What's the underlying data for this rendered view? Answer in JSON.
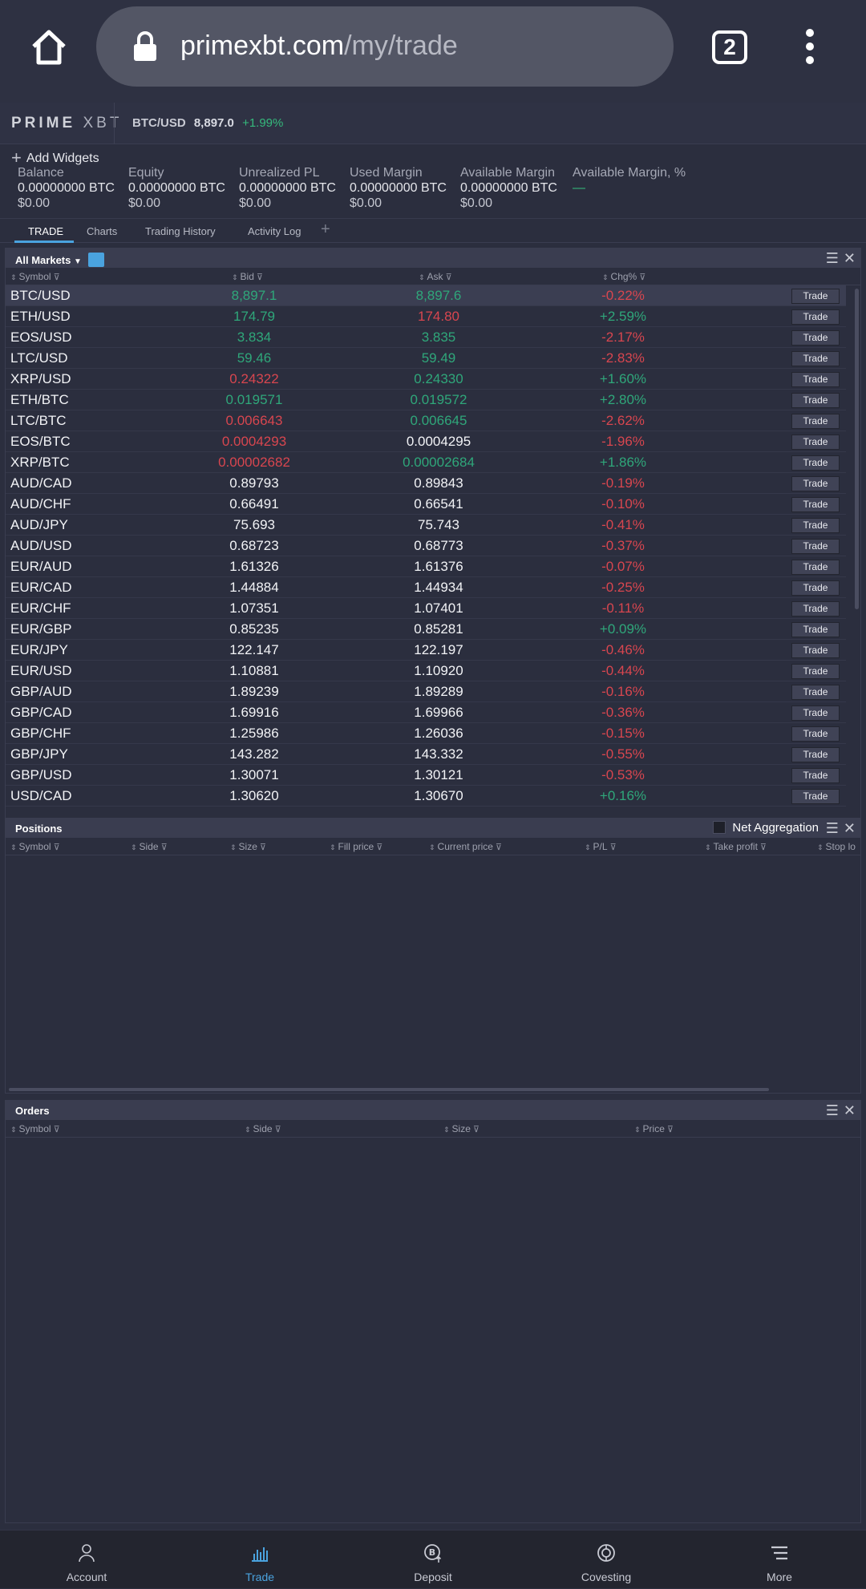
{
  "browser": {
    "domain": "primexbt.com",
    "path": "/my/trade",
    "tab_count": "2"
  },
  "topbar": {
    "logo_a": "PRIME",
    "logo_b": "XBT",
    "symbol": "BTC/USD",
    "price": "8,897.0",
    "change": "+1.99%"
  },
  "summary": {
    "add_widgets": "Add Widgets",
    "metrics": [
      {
        "label": "Balance",
        "value": "0.00000000 BTC",
        "usd": "$0.00"
      },
      {
        "label": "Equity",
        "value": "0.00000000 BTC",
        "usd": "$0.00"
      },
      {
        "label": "Unrealized PL",
        "value": "0.00000000 BTC",
        "usd": "$0.00"
      },
      {
        "label": "Used Margin",
        "value": "0.00000000 BTC",
        "usd": "$0.00"
      },
      {
        "label": "Available Margin",
        "value": "0.00000000 BTC",
        "usd": "$0.00"
      },
      {
        "label": "Available Margin, %",
        "value": "—",
        "usd": ""
      }
    ]
  },
  "tabs": [
    "TRADE",
    "Charts",
    "Trading History",
    "Activity Log"
  ],
  "markets": {
    "title": "All Markets",
    "columns": [
      "Symbol",
      "Bid",
      "Ask",
      "Chg%"
    ],
    "trade_label": "Trade",
    "rows": [
      {
        "symbol": "BTC/USD",
        "bid": "8,897.1",
        "bid_dir": "up",
        "ask": "8,897.6",
        "ask_dir": "up",
        "chg": "-0.22%",
        "chg_dir": "dn"
      },
      {
        "symbol": "ETH/USD",
        "bid": "174.79",
        "bid_dir": "up",
        "ask": "174.80",
        "ask_dir": "dn",
        "chg": "+2.59%",
        "chg_dir": "up"
      },
      {
        "symbol": "EOS/USD",
        "bid": "3.834",
        "bid_dir": "up",
        "ask": "3.835",
        "ask_dir": "up",
        "chg": "-2.17%",
        "chg_dir": "dn"
      },
      {
        "symbol": "LTC/USD",
        "bid": "59.46",
        "bid_dir": "up",
        "ask": "59.49",
        "ask_dir": "up",
        "chg": "-2.83%",
        "chg_dir": "dn"
      },
      {
        "symbol": "XRP/USD",
        "bid": "0.24322",
        "bid_dir": "dn",
        "ask": "0.24330",
        "ask_dir": "up",
        "chg": "+1.60%",
        "chg_dir": "up"
      },
      {
        "symbol": "ETH/BTC",
        "bid": "0.019571",
        "bid_dir": "up",
        "ask": "0.019572",
        "ask_dir": "up",
        "chg": "+2.80%",
        "chg_dir": "up"
      },
      {
        "symbol": "LTC/BTC",
        "bid": "0.006643",
        "bid_dir": "dn",
        "ask": "0.006645",
        "ask_dir": "up",
        "chg": "-2.62%",
        "chg_dir": "dn"
      },
      {
        "symbol": "EOS/BTC",
        "bid": "0.0004293",
        "bid_dir": "dn",
        "ask": "0.0004295",
        "ask_dir": "nt",
        "chg": "-1.96%",
        "chg_dir": "dn"
      },
      {
        "symbol": "XRP/BTC",
        "bid": "0.00002682",
        "bid_dir": "dn",
        "ask": "0.00002684",
        "ask_dir": "up",
        "chg": "+1.86%",
        "chg_dir": "up"
      },
      {
        "symbol": "AUD/CAD",
        "bid": "0.89793",
        "bid_dir": "nt",
        "ask": "0.89843",
        "ask_dir": "nt",
        "chg": "-0.19%",
        "chg_dir": "dn"
      },
      {
        "symbol": "AUD/CHF",
        "bid": "0.66491",
        "bid_dir": "nt",
        "ask": "0.66541",
        "ask_dir": "nt",
        "chg": "-0.10%",
        "chg_dir": "dn"
      },
      {
        "symbol": "AUD/JPY",
        "bid": "75.693",
        "bid_dir": "nt",
        "ask": "75.743",
        "ask_dir": "nt",
        "chg": "-0.41%",
        "chg_dir": "dn"
      },
      {
        "symbol": "AUD/USD",
        "bid": "0.68723",
        "bid_dir": "nt",
        "ask": "0.68773",
        "ask_dir": "nt",
        "chg": "-0.37%",
        "chg_dir": "dn"
      },
      {
        "symbol": "EUR/AUD",
        "bid": "1.61326",
        "bid_dir": "nt",
        "ask": "1.61376",
        "ask_dir": "nt",
        "chg": "-0.07%",
        "chg_dir": "dn"
      },
      {
        "symbol": "EUR/CAD",
        "bid": "1.44884",
        "bid_dir": "nt",
        "ask": "1.44934",
        "ask_dir": "nt",
        "chg": "-0.25%",
        "chg_dir": "dn"
      },
      {
        "symbol": "EUR/CHF",
        "bid": "1.07351",
        "bid_dir": "nt",
        "ask": "1.07401",
        "ask_dir": "nt",
        "chg": "-0.11%",
        "chg_dir": "dn"
      },
      {
        "symbol": "EUR/GBP",
        "bid": "0.85235",
        "bid_dir": "nt",
        "ask": "0.85281",
        "ask_dir": "nt",
        "chg": "+0.09%",
        "chg_dir": "up"
      },
      {
        "symbol": "EUR/JPY",
        "bid": "122.147",
        "bid_dir": "nt",
        "ask": "122.197",
        "ask_dir": "nt",
        "chg": "-0.46%",
        "chg_dir": "dn"
      },
      {
        "symbol": "EUR/USD",
        "bid": "1.10881",
        "bid_dir": "nt",
        "ask": "1.10920",
        "ask_dir": "nt",
        "chg": "-0.44%",
        "chg_dir": "dn"
      },
      {
        "symbol": "GBP/AUD",
        "bid": "1.89239",
        "bid_dir": "nt",
        "ask": "1.89289",
        "ask_dir": "nt",
        "chg": "-0.16%",
        "chg_dir": "dn"
      },
      {
        "symbol": "GBP/CAD",
        "bid": "1.69916",
        "bid_dir": "nt",
        "ask": "1.69966",
        "ask_dir": "nt",
        "chg": "-0.36%",
        "chg_dir": "dn"
      },
      {
        "symbol": "GBP/CHF",
        "bid": "1.25986",
        "bid_dir": "nt",
        "ask": "1.26036",
        "ask_dir": "nt",
        "chg": "-0.15%",
        "chg_dir": "dn"
      },
      {
        "symbol": "GBP/JPY",
        "bid": "143.282",
        "bid_dir": "nt",
        "ask": "143.332",
        "ask_dir": "nt",
        "chg": "-0.55%",
        "chg_dir": "dn"
      },
      {
        "symbol": "GBP/USD",
        "bid": "1.30071",
        "bid_dir": "nt",
        "ask": "1.30121",
        "ask_dir": "nt",
        "chg": "-0.53%",
        "chg_dir": "dn"
      },
      {
        "symbol": "USD/CAD",
        "bid": "1.30620",
        "bid_dir": "nt",
        "ask": "1.30670",
        "ask_dir": "nt",
        "chg": "+0.16%",
        "chg_dir": "up"
      }
    ]
  },
  "positions": {
    "title": "Positions",
    "net_aggregation": "Net Aggregation",
    "columns": [
      "Symbol",
      "Side",
      "Size",
      "Fill price",
      "Current price",
      "P/L",
      "Take profit",
      "Stop lo"
    ]
  },
  "orders": {
    "title": "Orders",
    "columns": [
      "Symbol",
      "Side",
      "Size",
      "Price"
    ]
  },
  "bottom_nav": {
    "items": [
      "Account",
      "Trade",
      "Deposit",
      "Covesting",
      "More"
    ],
    "active": "Trade"
  },
  "colors": {
    "up": "#2fa77a",
    "down": "#d8464f",
    "accent": "#4aa3df",
    "background": "#2b2e3e"
  }
}
